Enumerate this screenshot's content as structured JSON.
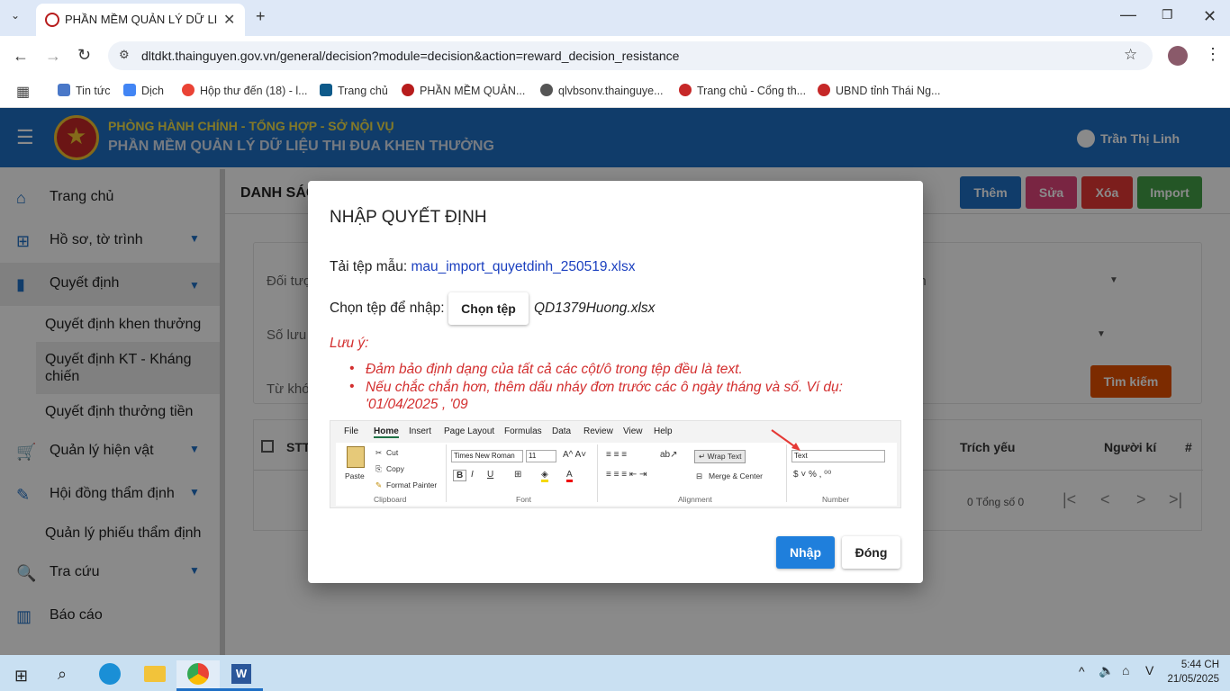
{
  "browser": {
    "tab_title": "PHẦN MỀM QUẢN LÝ DỮ LIỆU",
    "url": "dltdkt.thainguyen.gov.vn/general/decision?module=decision&action=reward_decision_resistance",
    "bookmarks": [
      {
        "label": "Tin tức",
        "color": "#4a78c8"
      },
      {
        "label": "Dịch",
        "color": "#4285f4"
      },
      {
        "label": "Hộp thư đến (18) - l...",
        "color": "#ea4335"
      },
      {
        "label": "Trang chủ",
        "color": "#0e5a8a"
      },
      {
        "label": "PHẦN MỀM QUẢN...",
        "color": "#b71c1c"
      },
      {
        "label": "qlvbsonv.thainguye...",
        "color": "#555555"
      },
      {
        "label": "Trang chủ - Cổng th...",
        "color": "#c62828"
      },
      {
        "label": "UBND tỉnh Thái Ng...",
        "color": "#c62828"
      }
    ]
  },
  "header": {
    "subtitle": "PHÒNG HÀNH CHÍNH - TỔNG HỢP - SỞ NỘI VỤ",
    "title": "PHẦN MỀM QUẢN LÝ DỮ LIỆU THI ĐUA KHEN THƯỞNG",
    "user": "Trần Thị Linh"
  },
  "sidebar": {
    "items": [
      {
        "label": "Trang chủ"
      },
      {
        "label": "Hồ sơ, tờ trình"
      },
      {
        "label": "Quyết định"
      },
      {
        "label": "Quản lý hiện vật"
      },
      {
        "label": "Hội đồng thẩm định"
      },
      {
        "label": "Tra cứu"
      },
      {
        "label": "Báo cáo"
      }
    ],
    "subitems": [
      "Quyết định khen thưởng",
      "Quyết định KT - Kháng chiến",
      "Quyết định thưởng tiền",
      "Quản lý phiếu thẩm định"
    ]
  },
  "main": {
    "page_title": "DANH SÁC",
    "buttons": {
      "add": "Thêm",
      "edit": "Sửa",
      "delete": "Xóa",
      "import": "Import",
      "search": "Tìm kiếm"
    },
    "filters": {
      "f1": "Đối tượ",
      "f2": "Số lưu",
      "f3": "Từ khó",
      "f4": "nh"
    },
    "table": {
      "col_stt": "STT",
      "col_summary": "Trích yếu",
      "col_signer": "Người kí",
      "col_hash": "#"
    },
    "pagination": "0 Tổng số 0"
  },
  "modal": {
    "title": "NHẬP QUYẾT ĐỊNH",
    "template_label": "Tải tệp mẫu:",
    "template_link": "mau_import_quyetdinh_250519.xlsx",
    "choose_label": "Chọn tệp để nhập:",
    "choose_button": "Chọn tệp",
    "chosen_file": "QD1379Huong.xlsx",
    "note_title": "Lưu ý:",
    "note_1": "Đảm bảo định dạng của tất cả các cột/ô trong tệp đều là text.",
    "note_2a": "Nếu chắc chắn hơn, thêm dấu nháy đơn trước các ô ngày tháng và số. Ví dụ:",
    "note_2b": "'01/04/2025 , '09",
    "ok_button": "Nhập",
    "close_button": "Đóng",
    "ribbon": {
      "menus": [
        "File",
        "Home",
        "Insert",
        "Page Layout",
        "Formulas",
        "Data",
        "Review",
        "View",
        "Help"
      ],
      "paste": "Paste",
      "cut": "Cut",
      "copy": "Copy",
      "format_painter": "Format Painter",
      "clipboard": "Clipboard",
      "font_name": "Times New Roman",
      "font_size": "11",
      "font": "Font",
      "wrap_text": "Wrap Text",
      "merge_center": "Merge & Center",
      "alignment": "Alignment",
      "number_format": "Text",
      "number": "Number"
    }
  },
  "taskbar": {
    "time": "5:44 CH",
    "date": "21/05/2025"
  }
}
